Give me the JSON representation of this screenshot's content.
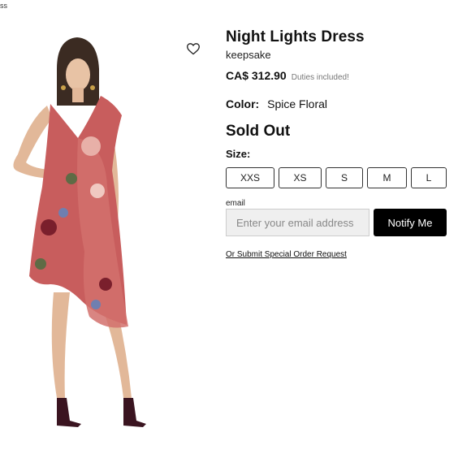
{
  "breadcrumb": "ss",
  "product": {
    "name": "Night Lights Dress",
    "brand": "keepsake",
    "price": "CA$ 312.90",
    "duties_note": "Duties included!",
    "color_label": "Color:",
    "color_value": "Spice Floral",
    "availability": "Sold Out",
    "size_label": "Size:",
    "sizes": [
      "XXS",
      "XS",
      "S",
      "M",
      "L"
    ]
  },
  "notify": {
    "email_label": "email",
    "email_placeholder": "Enter your email address",
    "email_value": "",
    "button_label": "Notify Me"
  },
  "special_order_link": "Or Submit Special Order Request",
  "icons": {
    "wishlist": "heart-outline-icon"
  },
  "colors": {
    "dress": "#c85d5d",
    "button": "#000000",
    "input_bg": "#efefef"
  }
}
